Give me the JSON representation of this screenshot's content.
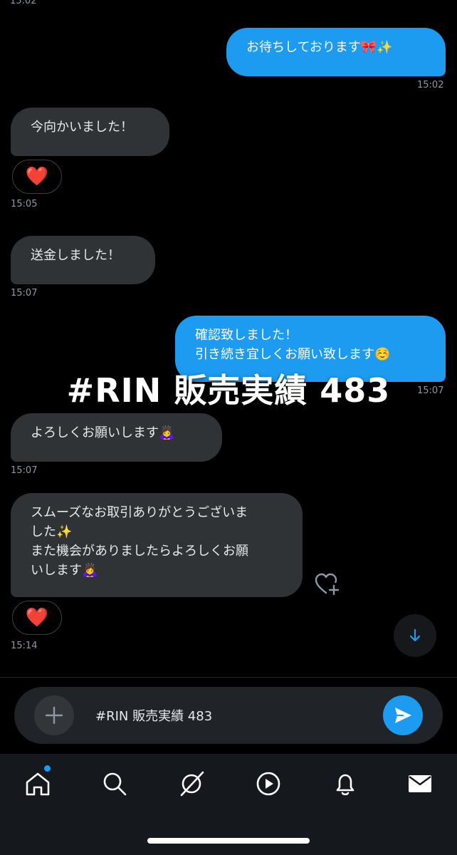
{
  "top_time": "15:02",
  "messages": [
    {
      "text": "お待ちしております🎀✨",
      "time": "15:02"
    },
    {
      "text": "今向かいました！",
      "reaction": "❤️",
      "time": "15:05"
    },
    {
      "text": "送金しました！",
      "time": "15:07"
    },
    {
      "text": "確認致しました！\n引き続き宜しくお願い致します☺️",
      "time": "15:07"
    },
    {
      "text": "よろしくお願いします🙇‍♀️",
      "time": "15:07"
    },
    {
      "text": "スムーズなお取引ありがとうございま\nした✨\nまた機会がありましたらよろしくお願\nいします🙇‍♀️",
      "reaction": "❤️",
      "time": "15:14"
    }
  ],
  "overlay_text": "#RIN 販売実績 483",
  "composer": {
    "value": "#RIN 販売実績 483"
  },
  "tabs": [
    "home-icon",
    "search-icon",
    "grok-icon",
    "video-icon",
    "notifications-icon",
    "messages-icon"
  ],
  "colors": {
    "accent": "#1d9bf0",
    "incoming_bubble": "#2f3336",
    "background": "#000000"
  }
}
